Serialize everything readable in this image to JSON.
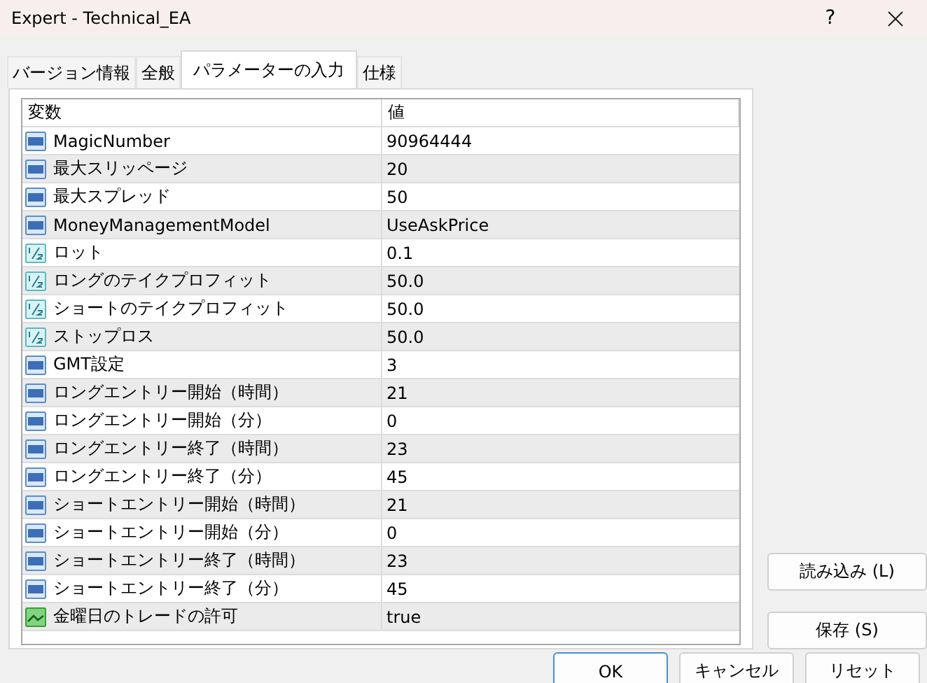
{
  "window": {
    "title": "Expert - Technical_EA",
    "help": "?"
  },
  "tabs": [
    {
      "label": "バージョン情報",
      "selected": false
    },
    {
      "label": "全般",
      "selected": false
    },
    {
      "label": "パラメーターの入力",
      "selected": true
    },
    {
      "label": "仕様",
      "selected": false
    }
  ],
  "table": {
    "columns": [
      "変数",
      "値"
    ],
    "rows": [
      {
        "kind": "int",
        "name": "MagicNumber",
        "value": "90964444"
      },
      {
        "kind": "int",
        "name": "最大スリッページ",
        "value": "20"
      },
      {
        "kind": "int",
        "name": "最大スプレッド",
        "value": "50"
      },
      {
        "kind": "int",
        "name": "MoneyManagementModel",
        "value": "UseAskPrice"
      },
      {
        "kind": "double",
        "name": "ロット",
        "value": "0.1"
      },
      {
        "kind": "double",
        "name": "ロングのテイクプロフィット",
        "value": "50.0"
      },
      {
        "kind": "double",
        "name": "ショートのテイクプロフィット",
        "value": "50.0"
      },
      {
        "kind": "double",
        "name": "ストップロス",
        "value": "50.0"
      },
      {
        "kind": "int",
        "name": "GMT設定",
        "value": "3"
      },
      {
        "kind": "int",
        "name": "ロングエントリー開始（時間）",
        "value": "21"
      },
      {
        "kind": "int",
        "name": "ロングエントリー開始（分）",
        "value": "0"
      },
      {
        "kind": "int",
        "name": "ロングエントリー終了（時間）",
        "value": "23"
      },
      {
        "kind": "int",
        "name": "ロングエントリー終了（分）",
        "value": "45"
      },
      {
        "kind": "int",
        "name": "ショートエントリー開始（時間）",
        "value": "21"
      },
      {
        "kind": "int",
        "name": "ショートエントリー開始（分）",
        "value": "0"
      },
      {
        "kind": "int",
        "name": "ショートエントリー終了（時間）",
        "value": "23"
      },
      {
        "kind": "int",
        "name": "ショートエントリー終了（分）",
        "value": "45"
      },
      {
        "kind": "bool",
        "name": "金曜日のトレードの許可",
        "value": "true"
      }
    ]
  },
  "side_buttons": [
    "読み込み (L)",
    "保存 (S)"
  ],
  "buttons": [
    "OK",
    "キャンセル",
    "リセット"
  ]
}
